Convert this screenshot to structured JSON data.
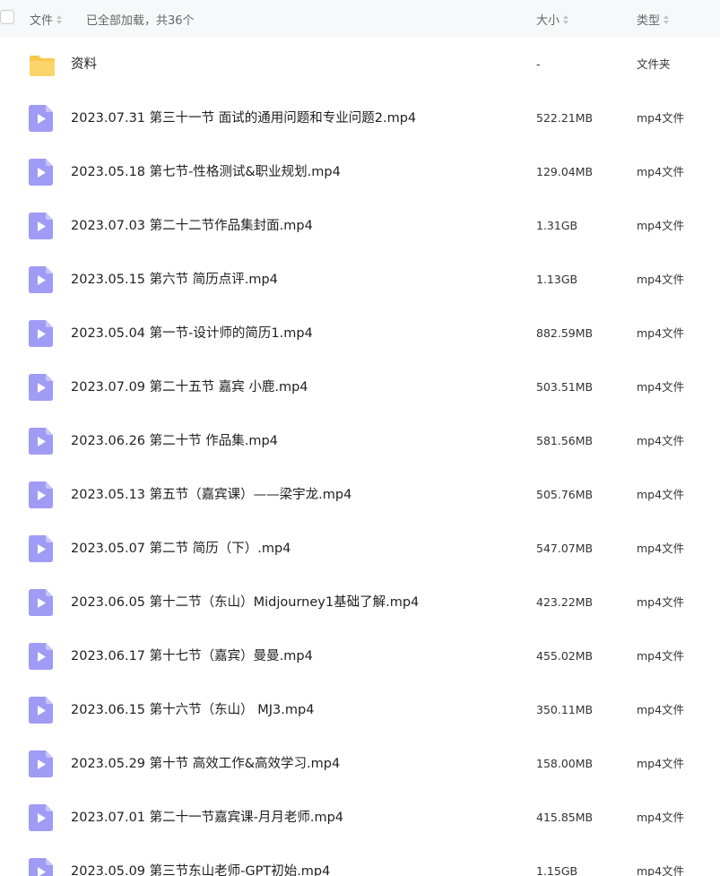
{
  "header": {
    "name_label": "文件",
    "loaded_text": "已全部加载，共36个",
    "size_label": "大小",
    "type_label": "类型"
  },
  "colors": {
    "folder": "#f9c84a",
    "video": "#a09bf5",
    "header_bg": "#f7f8fa"
  },
  "files": [
    {
      "name": "资料",
      "size": "-",
      "type": "文件夹",
      "icon": "folder-icon"
    },
    {
      "name": "2023.07.31 第三十一节 面试的通用问题和专业问题2.mp4",
      "size": "522.21MB",
      "type": "mp4文件",
      "icon": "video-file-icon"
    },
    {
      "name": "2023.05.18 第七节-性格测试&职业规划.mp4",
      "size": "129.04MB",
      "type": "mp4文件",
      "icon": "video-file-icon"
    },
    {
      "name": "2023.07.03 第二十二节作品集封面.mp4",
      "size": "1.31GB",
      "type": "mp4文件",
      "icon": "video-file-icon"
    },
    {
      "name": "2023.05.15 第六节 简历点评.mp4",
      "size": "1.13GB",
      "type": "mp4文件",
      "icon": "video-file-icon"
    },
    {
      "name": "2023.05.04 第一节-设计师的简历1.mp4",
      "size": "882.59MB",
      "type": "mp4文件",
      "icon": "video-file-icon"
    },
    {
      "name": "2023.07.09 第二十五节 嘉宾 小鹿.mp4",
      "size": "503.51MB",
      "type": "mp4文件",
      "icon": "video-file-icon"
    },
    {
      "name": "2023.06.26 第二十节 作品集.mp4",
      "size": "581.56MB",
      "type": "mp4文件",
      "icon": "video-file-icon"
    },
    {
      "name": "2023.05.13 第五节（嘉宾课）——梁宇龙.mp4",
      "size": "505.76MB",
      "type": "mp4文件",
      "icon": "video-file-icon"
    },
    {
      "name": "2023.05.07 第二节 简历（下）.mp4",
      "size": "547.07MB",
      "type": "mp4文件",
      "icon": "video-file-icon"
    },
    {
      "name": "2023.06.05 第十二节（东山）Midjourney1基础了解.mp4",
      "size": "423.22MB",
      "type": "mp4文件",
      "icon": "video-file-icon"
    },
    {
      "name": "2023.06.17 第十七节（嘉宾）曼曼.mp4",
      "size": "455.02MB",
      "type": "mp4文件",
      "icon": "video-file-icon"
    },
    {
      "name": "2023.06.15 第十六节（东山） MJ3.mp4",
      "size": "350.11MB",
      "type": "mp4文件",
      "icon": "video-file-icon"
    },
    {
      "name": "2023.05.29 第十节 高效工作&高效学习.mp4",
      "size": "158.00MB",
      "type": "mp4文件",
      "icon": "video-file-icon"
    },
    {
      "name": "2023.07.01 第二十一节嘉宾课-月月老师.mp4",
      "size": "415.85MB",
      "type": "mp4文件",
      "icon": "video-file-icon"
    },
    {
      "name": "2023.05.09 第三节东山老师-GPT初始.mp4",
      "size": "1.15GB",
      "type": "mp4文件",
      "icon": "video-file-icon"
    }
  ]
}
